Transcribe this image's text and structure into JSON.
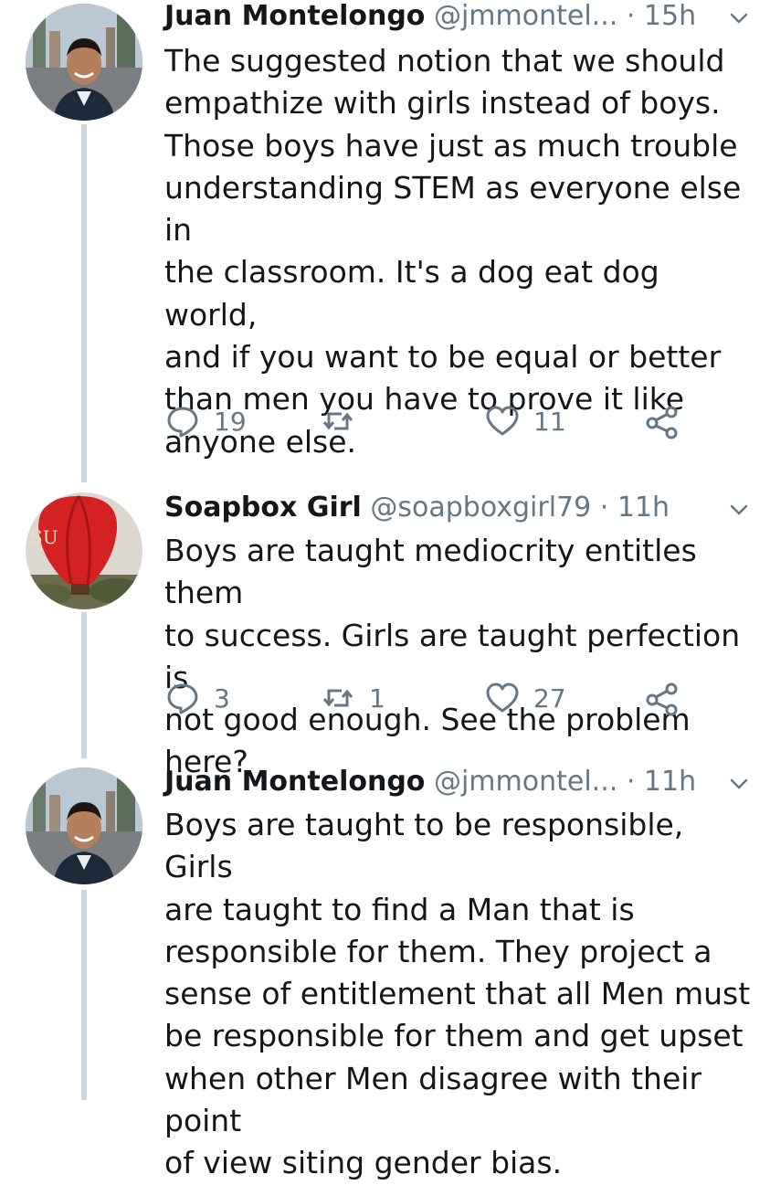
{
  "tweets": [
    {
      "name": "Juan Montelongo",
      "handle": "@jmmontel...",
      "time": "· 15h",
      "avatar": "man-smiling-street-avatar",
      "lines": [
        "The suggested notion that we should",
        "empathize with girls instead of boys.",
        "Those boys have just as much trouble",
        "understanding STEM as everyone else in",
        "the classroom. It's a dog eat dog world,",
        "and if you want to be equal or better",
        "than men you have to prove it like",
        "anyone else."
      ],
      "replies": "19",
      "retweets": "",
      "likes": "11"
    },
    {
      "name": "Soapbox Girl",
      "handle": "@soapboxgirl79",
      "time": "· 11h",
      "avatar": "hot-air-balloon-avatar",
      "avatar_text": "SU",
      "lines": [
        "Boys are taught mediocrity entitles them",
        "to success. Girls are taught perfection is",
        "not good enough. See the problem here?"
      ],
      "replies": "3",
      "retweets": "1",
      "likes": "27"
    },
    {
      "name": "Juan Montelongo",
      "handle": "@jmmontel...",
      "time": "· 11h",
      "avatar": "man-smiling-street-avatar",
      "lines": [
        "Boys are taught to be responsible, Girls",
        "are taught to find a Man that is",
        "responsible for them. They project a",
        "sense of entitlement that all Men must",
        "be responsible for them and get upset",
        "when other Men disagree with their point",
        "of view siting gender bias."
      ]
    }
  ],
  "icons": {
    "reply": "speech-bubble-icon",
    "retweet": "retweet-icon",
    "like": "heart-icon",
    "share": "share-icon",
    "caret": "chevron-down-icon"
  },
  "colors": {
    "text": "#14171a",
    "secondary": "#657786",
    "thread_line": "#ccd6dd",
    "balloon": "#d42222"
  }
}
